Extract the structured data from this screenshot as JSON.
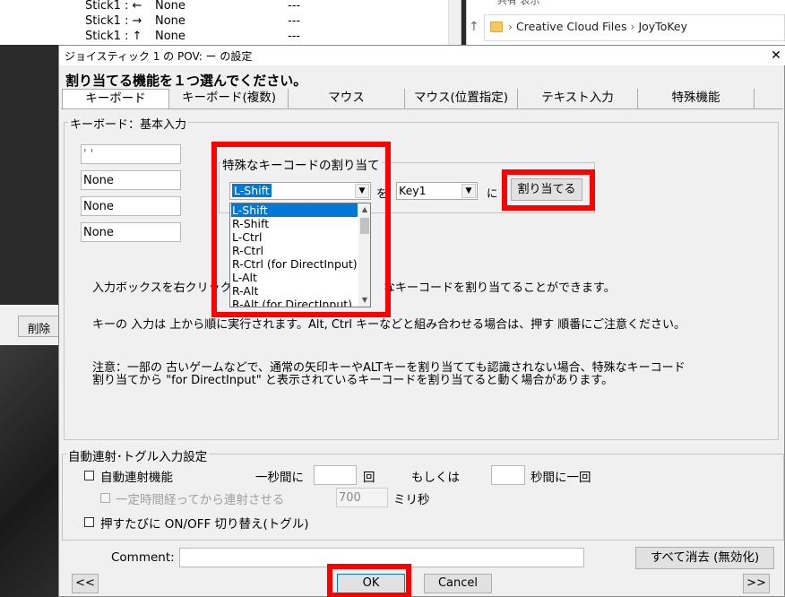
{
  "background": {
    "stick_rows": [
      {
        "key": "Stick1 : ←",
        "value": "None",
        "extra": "---"
      },
      {
        "key": "Stick1 : →",
        "value": "None",
        "extra": "---"
      },
      {
        "key": "Stick1 : ↑",
        "value": "None",
        "extra": "---"
      }
    ],
    "explorer_top_text": "共有    表示",
    "path_parts": [
      "Creative Cloud Files",
      "JoyToKey"
    ],
    "delete_button": "削除"
  },
  "dialog": {
    "title": "ジョイスティック 1 の POV: ー の設定",
    "heading": "割り当てる機能を１つ選んでください。",
    "tabs": [
      "キーボード",
      "キーボード(複数)",
      "マウス",
      "マウス(位置指定)",
      "テキスト入力",
      "特殊機能"
    ],
    "keyboard_group_label": "キーボード：基本入力",
    "key_inputs": [
      "' '",
      "None",
      "None",
      "None"
    ],
    "special_group_label": "特殊なキーコードの割り当て",
    "special_key_selected": "L-Shift",
    "wo_label": "を",
    "target_key_selected": "Key1",
    "ni_label": "に",
    "assign_button": "割り当てる",
    "dropdown_items": [
      "L-Shift",
      "R-Shift",
      "L-Ctrl",
      "R-Ctrl",
      "R-Ctrl (for DirectInput)",
      "L-Alt",
      "R-Alt",
      "R-Alt (for DirectInput)"
    ],
    "info_1": "入力ボックスを右クリック",
    "info_1b": "なキーコードを割り当てることができます。",
    "info_2": "キーの 入力は 上から順に実行されます。Alt, Ctrl キーなどと組み合わせる場合は、押す 順番にご注意ください。",
    "info_3a": "注意：一部の 古いゲームなどで、通常の矢印キーやALTキーを割り当てても認識されない場合、特殊なキーコード",
    "info_3b": "割り当てから \"for DirectInput\" と表示されているキーコードを割り当てると動く場合があります。",
    "auto_group_label": "自動連射･トグル入力設定",
    "auto_fire_label": "自動連射機能",
    "per_sec_label": "一秒間に",
    "times_label": "回",
    "or_label": "もしくは",
    "per_n_sec_label": "秒間に一回",
    "delay_label": "一定時間経ってから連射させる",
    "delay_value": "700",
    "ms_label": "ミリ秒",
    "toggle_label": "押すたびに ON/OFF 切り替え(トグル)",
    "comment_label": "Comment:",
    "clear_all_button": "すべて消去 (無効化)",
    "prev_button": "<<",
    "next_button": ">>",
    "ok_button": "OK",
    "cancel_button": "Cancel"
  },
  "colors": {
    "highlight": "#ff0000",
    "selection": "#0078d7"
  }
}
